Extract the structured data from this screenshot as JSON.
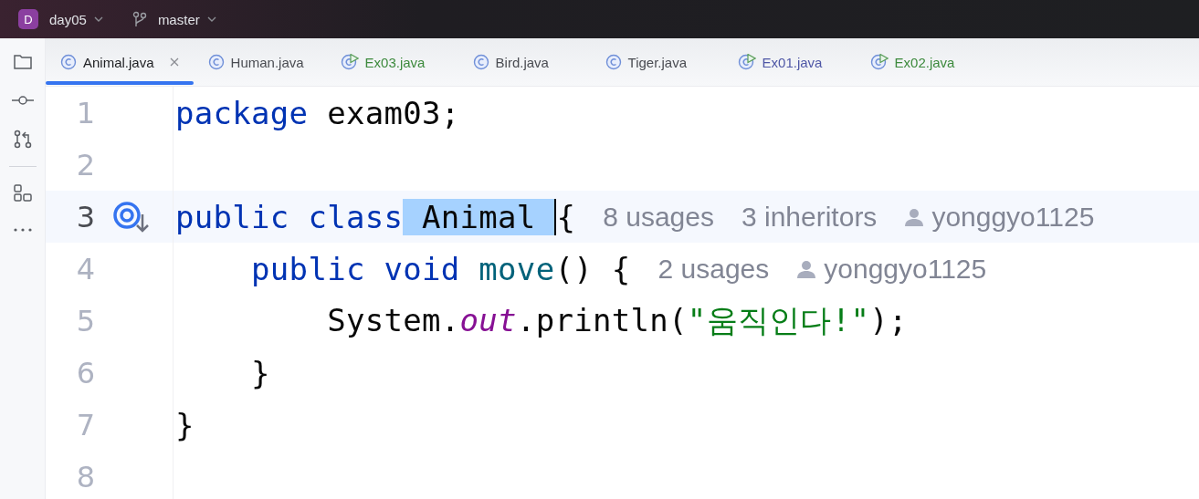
{
  "project": {
    "initial": "D",
    "name": "day05"
  },
  "branch": {
    "name": "master"
  },
  "tabs": [
    {
      "label": "Animal.java",
      "kind": "class",
      "selected": true,
      "color": "#1e1f22"
    },
    {
      "label": "Human.java",
      "kind": "class",
      "selected": false,
      "color": "#4a4c52"
    },
    {
      "label": "Ex03.java",
      "kind": "runnable",
      "selected": false,
      "color": "#3d8a3d"
    },
    {
      "label": "Bird.java",
      "kind": "class",
      "selected": false,
      "color": "#4a4c52"
    },
    {
      "label": "Tiger.java",
      "kind": "class",
      "selected": false,
      "color": "#4a4c52"
    },
    {
      "label": "Ex01.java",
      "kind": "runnable",
      "selected": false,
      "color": "#4f57a6"
    },
    {
      "label": "Ex02.java",
      "kind": "runnable",
      "selected": false,
      "color": "#3d8a3d"
    }
  ],
  "lines": [
    {
      "number": "1",
      "current": false,
      "marker": false,
      "tokens": [
        {
          "kind": "keyword",
          "text": "package"
        },
        {
          "kind": "plain",
          "text": " exam03;"
        }
      ]
    },
    {
      "number": "2",
      "current": false,
      "marker": false
    },
    {
      "number": "3",
      "current": true,
      "marker": true,
      "tokens": [
        {
          "kind": "keyword",
          "text": "public class"
        },
        {
          "kind": "selection",
          "text": " Animal "
        },
        {
          "kind": "plain",
          "text": "{"
        }
      ],
      "hints": [
        {
          "kind": "count",
          "text": "8 usages"
        },
        {
          "kind": "count",
          "text": "3 inheritors"
        },
        {
          "kind": "author",
          "text": "yonggyo1125"
        }
      ]
    },
    {
      "number": "4",
      "current": false,
      "marker": false,
      "tokens": [
        {
          "kind": "keyword",
          "text": "    public void"
        },
        {
          "kind": "method",
          "text": " move"
        },
        {
          "kind": "plain",
          "text": "() {"
        }
      ],
      "hints": [
        {
          "kind": "count",
          "text": "2 usages"
        },
        {
          "kind": "author",
          "text": "yonggyo1125"
        }
      ]
    },
    {
      "number": "5",
      "current": false,
      "marker": false,
      "tokens": [
        {
          "kind": "plain",
          "text": "        System."
        },
        {
          "kind": "field",
          "text": "out"
        },
        {
          "kind": "plain",
          "text": ".println("
        },
        {
          "kind": "string",
          "text": "\"움직인다!\""
        },
        {
          "kind": "plain",
          "text": ");"
        }
      ]
    },
    {
      "number": "6",
      "current": false,
      "marker": false,
      "tokens": [
        {
          "kind": "plain",
          "text": "    }"
        }
      ]
    },
    {
      "number": "7",
      "current": false,
      "marker": false,
      "tokens": [
        {
          "kind": "plain",
          "text": "}"
        }
      ]
    },
    {
      "number": "8",
      "current": false,
      "marker": false
    }
  ]
}
